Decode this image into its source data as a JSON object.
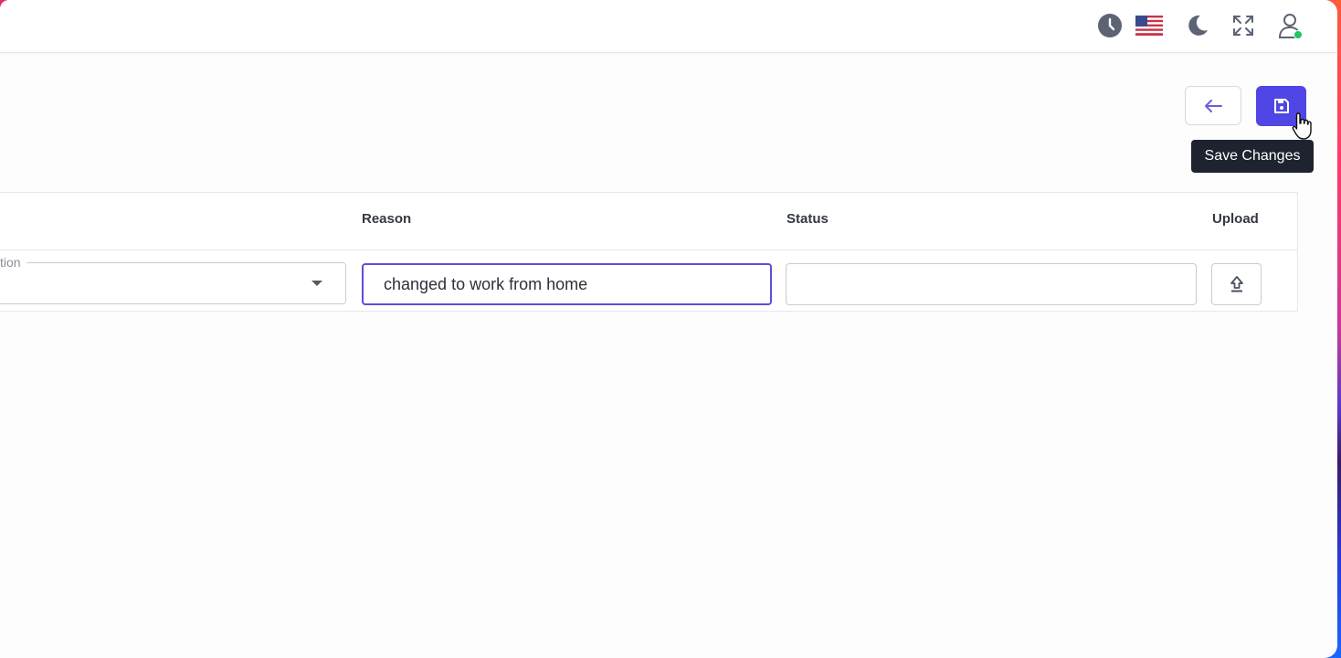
{
  "topbar": {
    "icons": [
      "clock-icon",
      "us-flag-icon",
      "moon-icon",
      "fullscreen-icon",
      "user-icon"
    ],
    "user_status_color": "#22c55e"
  },
  "actions": {
    "back_icon": "arrow-left-icon",
    "save_icon": "floppy-disk-icon",
    "save_tooltip": "Save Changes",
    "accent_color": "#4f46e5"
  },
  "table": {
    "headers": {
      "reason": "Reason",
      "status": "Status",
      "upload": "Upload"
    },
    "row": {
      "select_label": "tion",
      "reason_value": "changed to work from home",
      "status_value": "",
      "upload_icon": "upload-icon"
    }
  }
}
